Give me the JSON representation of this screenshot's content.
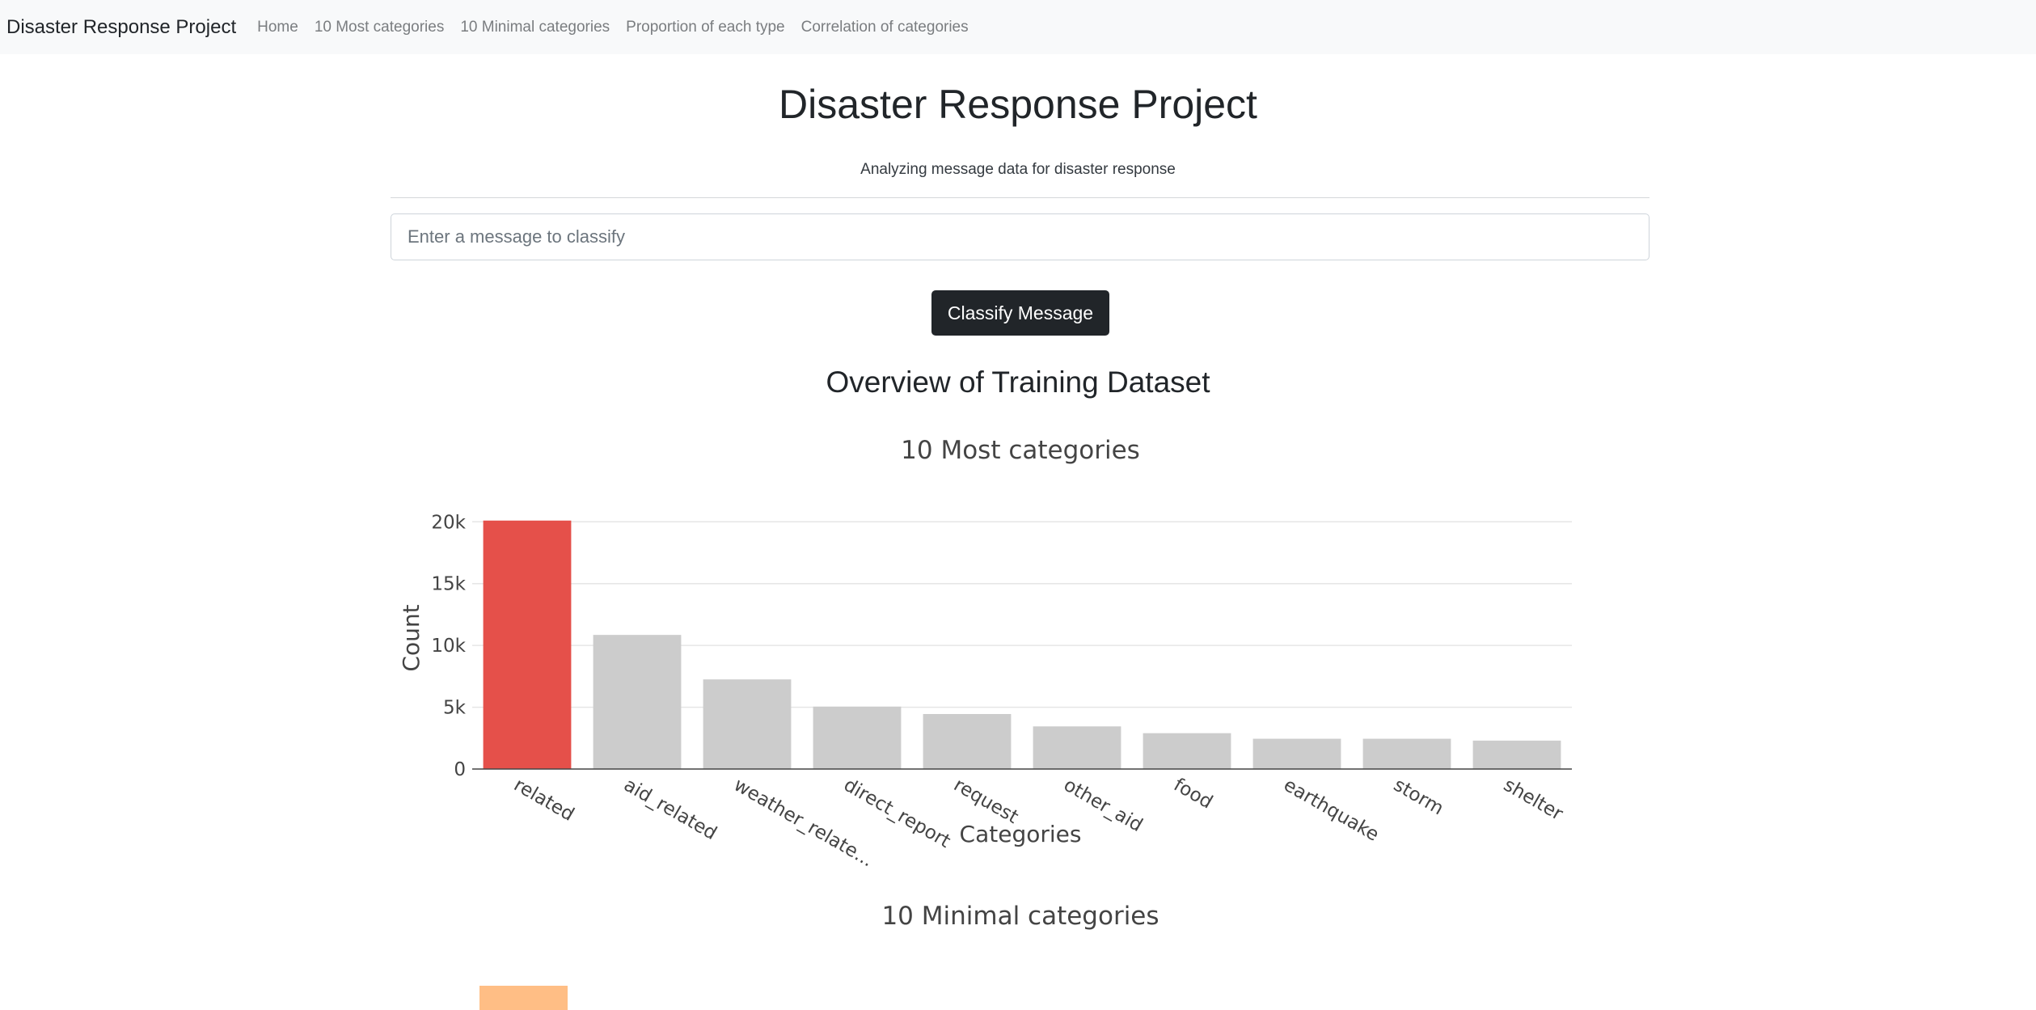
{
  "navbar": {
    "brand": "Disaster Response Project",
    "links": [
      "Home",
      "10 Most categories",
      "10 Minimal categories",
      "Proportion of each type",
      "Correlation of categories"
    ]
  },
  "header": {
    "title": "Disaster Response Project",
    "subtitle": "Analyzing message data for disaster response"
  },
  "form": {
    "placeholder": "Enter a message to classify",
    "button_label": "Classify Message"
  },
  "overview": {
    "title": "Overview of Training Dataset"
  },
  "colors": {
    "highlight_bar": "#e5504a",
    "default_bar": "#cccccc",
    "second_chart_bar": "#ffbe85",
    "button_bg": "#212529",
    "navbar_bg": "#f8f9fa"
  },
  "chart_data": [
    {
      "type": "bar",
      "title": "10 Most categories",
      "xlabel": "Categories",
      "ylabel": "Count",
      "categories": [
        "related",
        "aid_related",
        "weather_relate...",
        "direct_report",
        "request",
        "other_aid",
        "food",
        "earthquake",
        "storm",
        "shelter"
      ],
      "values": [
        20100,
        10850,
        7250,
        5050,
        4450,
        3450,
        2900,
        2450,
        2450,
        2300
      ],
      "ylim": [
        0,
        21000
      ],
      "yticks": [
        0,
        5000,
        10000,
        15000,
        20000
      ],
      "ytick_labels": [
        "0",
        "5k",
        "10k",
        "15k",
        "20k"
      ],
      "grid": true,
      "highlight_index": 0
    },
    {
      "type": "bar",
      "title": "10 Minimal categories",
      "categories": [],
      "values": []
    }
  ]
}
